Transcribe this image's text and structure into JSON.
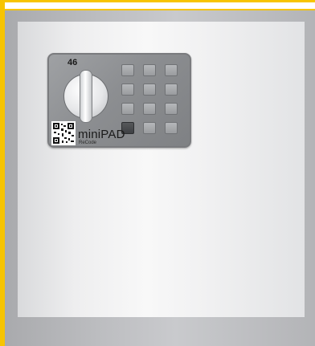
{
  "colors": {
    "accent": "#f7c400",
    "frame": "#b3b4b7",
    "panel": "#f2f2f3",
    "lock_body": "#8c8e91"
  },
  "lock": {
    "code": "46",
    "brand": "miniPAD",
    "sub_brand": "ReCode",
    "keys": [
      "",
      "",
      "",
      "",
      "",
      "",
      "",
      "",
      "",
      "",
      "",
      ""
    ],
    "icons": [
      "rotary-knob-icon",
      "qr-code-icon"
    ]
  }
}
